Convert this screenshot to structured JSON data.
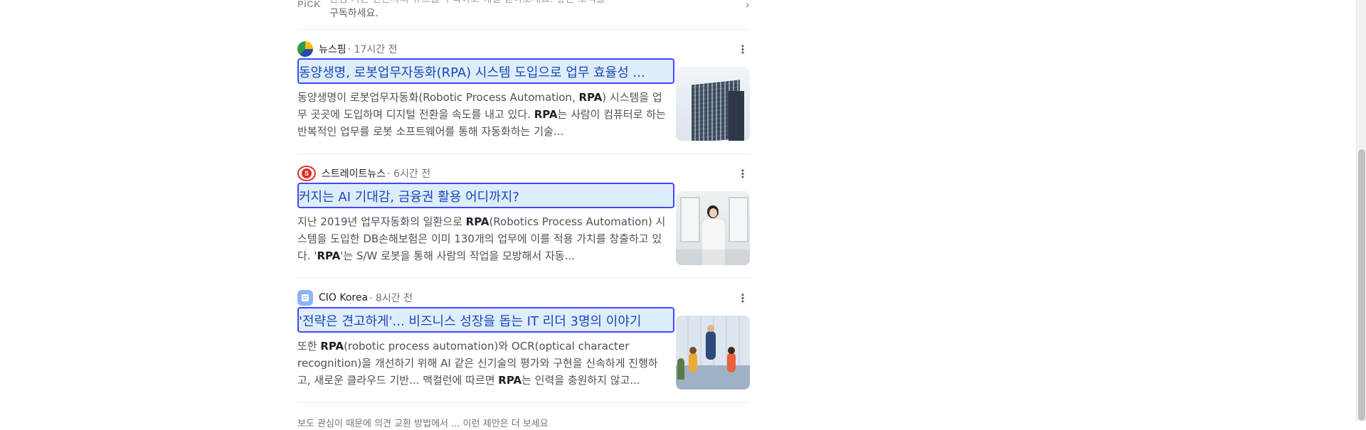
{
  "top_card": {
    "logo": "PiCK",
    "text_line1": "관심 가는 언론사의 뉴스를 구독하고 매일 받아보세요. 좋은 소식을",
    "text_line2": "구독하세요."
  },
  "articles": [
    {
      "source": "뉴스핌",
      "time": "· 17시간 전",
      "headline": "동양생명, 로봇업무자동화(RPA) 시스템 도입으로 업무 효율성 ...",
      "snippet_html": "동양생명이 로봇업무자동화(Robotic Process Automation, <b>RPA</b>) 시스템을 업무 곳곳에 도입하며 디지털 전환을 속도를 내고 있다. <b>RPA</b>는 사람이 컴퓨터로 하는 반복적인 업무를 로봇 소프트웨어를 통해 자동화하는 기술..."
    },
    {
      "source": "스트레이트뉴스",
      "time": "· 6시간 전",
      "headline": "커지는 AI 기대감, 금융권 활용 어디까지?",
      "snippet_html": "지난 2019년 업무자동화의 일환으로 <b>RPA</b>(Robotics Process Automation) 시스템을 도입한 DB손해보험은 이미 130개의 업무에 이를 적용 가치를 창출하고 있다. '<b>RPA</b>'는 S/W 로봇을 통해 사람의 작업을 모방해서 자동..."
    },
    {
      "source": "CIO Korea",
      "time": "· 8시간 전",
      "headline": "'전략은 견고하게'... 비즈니스 성장을 돕는 IT 리더 3명의 이야기",
      "snippet_html": "또한 <b>RPA</b>(robotic process automation)와 OCR(optical character recognition)을 개선하기 위해 AI 같은 신기술의 평가와 구현을 신속하게 진행하고, 새로운 클라우드 기반... 맥컬런에 따르면 <b>RPA</b>는 인력을 충원하지 않고..."
    }
  ],
  "more_icon": "⋮",
  "chevron_icon": "›",
  "bottom_cut_text": "보도 관심이 때문에 의견 교환 방법에서 ... 이런 제안은 더 보세요"
}
